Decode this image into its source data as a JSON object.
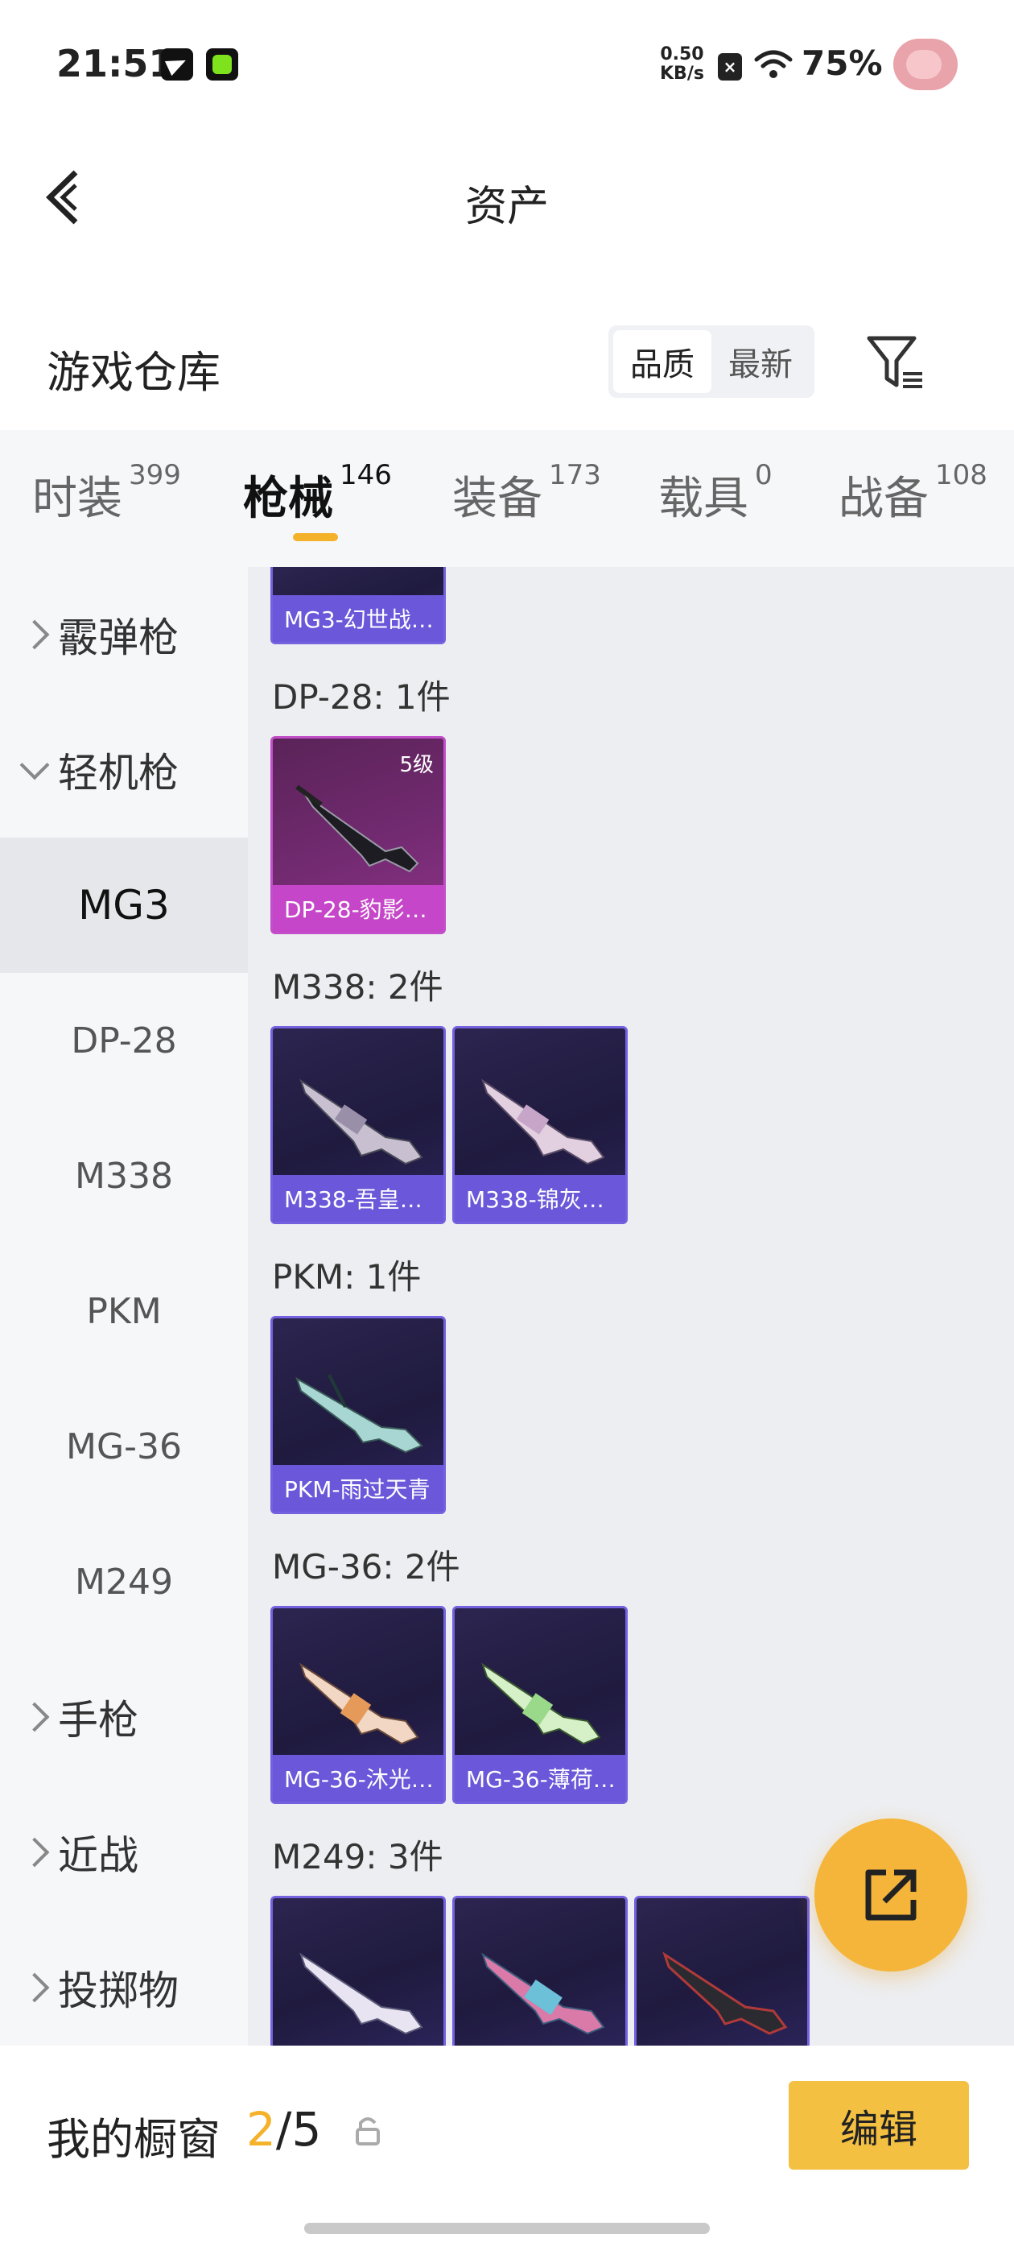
{
  "status_bar": {
    "time": "21:51",
    "net_speed_value": "0.50",
    "net_speed_unit": "KB/s",
    "battery": "75%",
    "icons": [
      "telegram-icon",
      "app-green-icon",
      "sim-off-icon",
      "wifi-icon",
      "avatar-icon"
    ]
  },
  "header": {
    "title": "资产",
    "back_icon": "chevron-left-icon"
  },
  "section": {
    "title": "游戏仓库",
    "sort_options": [
      "品质",
      "最新"
    ],
    "sort_selected": "品质",
    "filter_icon": "filter-icon"
  },
  "tabs": [
    {
      "label": "时装",
      "count": "399"
    },
    {
      "label": "枪械",
      "count": "146",
      "active": true
    },
    {
      "label": "装备",
      "count": "173"
    },
    {
      "label": "载具",
      "count": "0"
    },
    {
      "label": "战备",
      "count": "108"
    }
  ],
  "sidebar": {
    "categories": [
      {
        "label": "霰弹枪",
        "expanded": false
      },
      {
        "label": "轻机枪",
        "expanded": true
      },
      {
        "label": "手枪",
        "expanded": false
      },
      {
        "label": "近战",
        "expanded": false
      },
      {
        "label": "投掷物",
        "expanded": false
      }
    ],
    "sub_items": [
      "MG3",
      "DP-28",
      "M338",
      "PKM",
      "MG-36",
      "M249"
    ],
    "active_sub": "MG3"
  },
  "content": {
    "top_partial_card": {
      "name": "MG3-幻世战…"
    },
    "groups": [
      {
        "title": "DP-28: 1件",
        "items": [
          {
            "name": "DP-28-豹影…",
            "level": "5级",
            "rarity": "pink"
          }
        ]
      },
      {
        "title": "M338: 2件",
        "items": [
          {
            "name": "M338-吾皇…",
            "rarity": "purple"
          },
          {
            "name": "M338-锦灰…",
            "rarity": "purple"
          }
        ]
      },
      {
        "title": "PKM: 1件",
        "items": [
          {
            "name": "PKM-雨过天青",
            "rarity": "purple"
          }
        ]
      },
      {
        "title": "MG-36: 2件",
        "items": [
          {
            "name": "MG-36-沐光…",
            "rarity": "purple"
          },
          {
            "name": "MG-36-薄荷…",
            "rarity": "purple"
          }
        ]
      },
      {
        "title": "M249: 3件",
        "items": [
          {
            "name": "",
            "rarity": "purple"
          },
          {
            "name": "",
            "rarity": "purple"
          },
          {
            "name": "",
            "rarity": "purple"
          }
        ]
      }
    ]
  },
  "fab": {
    "icon": "share-icon"
  },
  "bottom": {
    "showcase_label": "我的橱窗",
    "showcase_current": "2",
    "showcase_total": "/5",
    "lock_icon": "lock-icon",
    "edit_label": "编辑"
  },
  "colors": {
    "accent": "#f4b12a",
    "purple_card": "#6a57d9",
    "pink_card": "#c546c8"
  }
}
